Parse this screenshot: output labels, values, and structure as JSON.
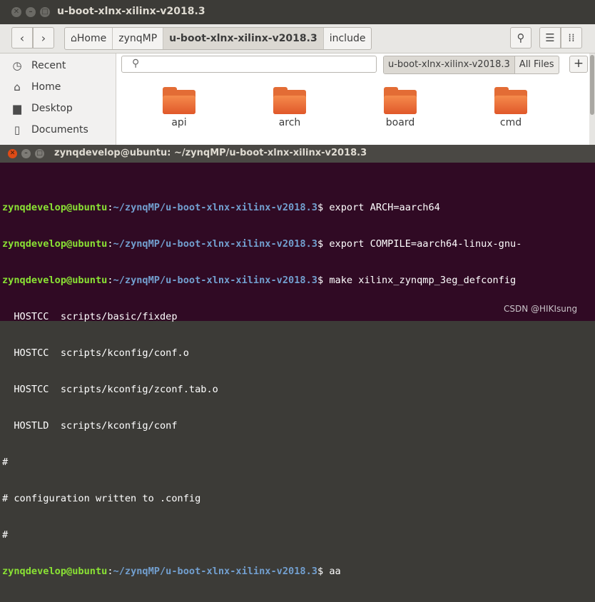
{
  "files_window": {
    "title": "u-boot-xlnx-xilinx-v2018.3",
    "window_buttons": [
      "close-icon",
      "minimize-icon",
      "maximize-icon"
    ],
    "breadcrumbs": [
      {
        "label": "Home",
        "icon": "home-icon"
      },
      {
        "label": "zynqMP"
      },
      {
        "label": "u-boot-xlnx-xilinx-v2018.3",
        "active": true
      },
      {
        "label": "include"
      }
    ],
    "sidebar": [
      {
        "label": "Recent",
        "icon": "clock-icon"
      },
      {
        "label": "Home",
        "icon": "home-icon"
      },
      {
        "label": "Desktop",
        "icon": "folder-icon"
      },
      {
        "label": "Documents",
        "icon": "document-icon"
      }
    ],
    "search": {
      "placeholder": ""
    },
    "location": {
      "path": "u-boot-xlnx-xilinx-v2018.3",
      "scope": "All Files"
    },
    "add_tab_label": "+",
    "folders": [
      "api",
      "arch",
      "board",
      "cmd"
    ],
    "colors": {
      "folder": "#e36c35",
      "titlebar": "#3c3b37"
    }
  },
  "terminal": {
    "title": "zynqdevelop@ubuntu: ~/zynqMP/u-boot-xlnx-xilinx-v2018.3",
    "user": "zynqdevelop@ubuntu",
    "path": "~/zynqMP/u-boot-xlnx-xilinx-v2018.3",
    "commands": [
      "export ARCH=aarch64",
      "export COMPILE=aarch64-linux-gnu-",
      "make xilinx_zynqmp_3eg_defconfig"
    ],
    "output": [
      "  HOSTCC  scripts/basic/fixdep",
      "  HOSTCC  scripts/kconfig/conf.o",
      "  HOSTCC  scripts/kconfig/zconf.tab.o",
      "  HOSTLD  scripts/kconfig/conf",
      "#",
      "# configuration written to .config",
      "#"
    ],
    "last_command": "aa",
    "colors": {
      "background": "#300a24",
      "user": "#8ae234",
      "path": "#729fcf"
    }
  },
  "watermark": "CSDN @HIKIsung"
}
